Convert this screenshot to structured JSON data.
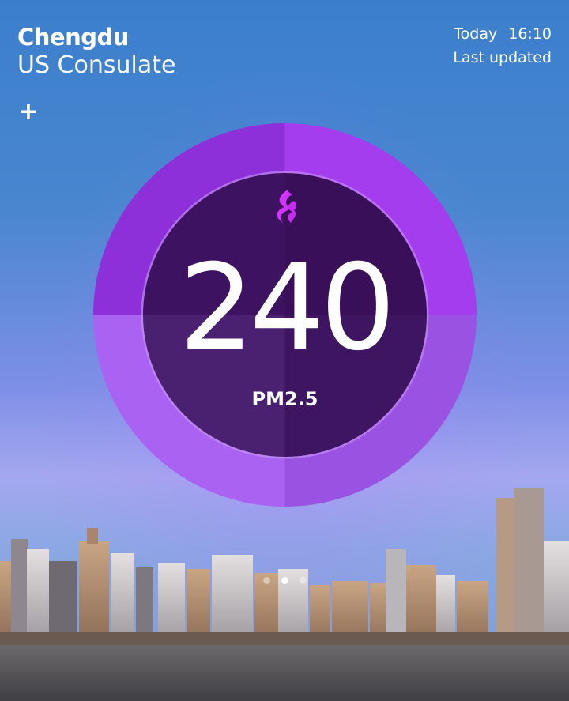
{
  "location": {
    "city": "Chengdu",
    "station": "US Consulate"
  },
  "update": {
    "day": "Today",
    "time": "16:10",
    "label": "Last updated"
  },
  "actions": {
    "add_symbol": "+"
  },
  "air_quality": {
    "value": "240",
    "pollutant": "PM2.5",
    "icon": "flame-icon",
    "level_color": "#9b3fe6"
  },
  "pager": {
    "page_count": 3,
    "active_page": 2
  },
  "colors": {
    "ring_light": "#b05cf0",
    "ring_dark": "#7a2fc9",
    "inner_dark": "#3a1158",
    "inner_light": "#4b1d72"
  }
}
